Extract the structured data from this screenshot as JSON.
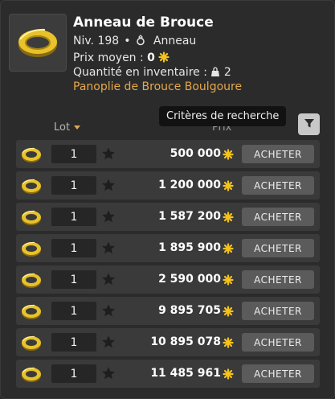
{
  "item": {
    "title": "Anneau de Brouce",
    "level": "Niv. 198",
    "type": "Anneau",
    "avg_price_label": "Prix moyen :",
    "avg_price_value": "0",
    "inventory_label": "Quantité en inventaire :",
    "inventory_value": "2",
    "set_name": "Panoplie de Brouce Boulgoure"
  },
  "tooltip": {
    "text": "Critères de recherche"
  },
  "columns": {
    "lot": "Lot",
    "prix": "Prix"
  },
  "colors": {
    "accent_gold": "#e5a84a",
    "kama_yellow": "#f5c21b",
    "row_bg": "#3a3a3a",
    "button_bg": "#5b5b5b",
    "panel_bg": "#2b2b2b"
  },
  "icons": {
    "item": "gold-ring-icon",
    "currency": "kama-icon",
    "favorite": "star-icon",
    "filter": "filter-icon",
    "type": "ring-type-icon",
    "inventory": "bag-icon"
  },
  "listings": [
    {
      "quantity": "1",
      "price": "500 000",
      "button": "ACHETER"
    },
    {
      "quantity": "1",
      "price": "1 200 000",
      "button": "ACHETER"
    },
    {
      "quantity": "1",
      "price": "1 587 200",
      "button": "ACHETER"
    },
    {
      "quantity": "1",
      "price": "1 895 900",
      "button": "ACHETER"
    },
    {
      "quantity": "1",
      "price": "2 590 000",
      "button": "ACHETER"
    },
    {
      "quantity": "1",
      "price": "9 895 705",
      "button": "ACHETER"
    },
    {
      "quantity": "1",
      "price": "10 895 078",
      "button": "ACHETER"
    },
    {
      "quantity": "1",
      "price": "11 485 961",
      "button": "ACHETER"
    }
  ]
}
